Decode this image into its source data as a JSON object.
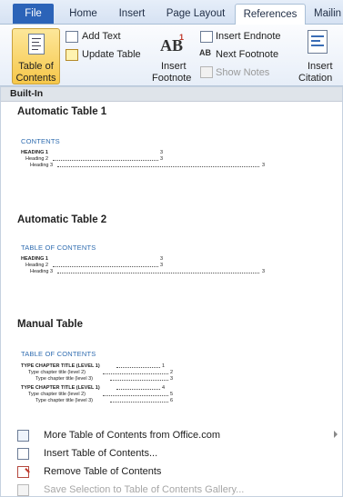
{
  "tabs": {
    "file": "File",
    "home": "Home",
    "insert": "Insert",
    "page_layout": "Page Layout",
    "references": "References",
    "mailings": "Mailin"
  },
  "ribbon": {
    "toc_label_line1": "Table of",
    "toc_label_line2": "Contents",
    "add_text": "Add Text",
    "update_table": "Update Table",
    "ab_icon": "AB",
    "ab_sup": "1",
    "insert_footnote_line1": "Insert",
    "insert_footnote_line2": "Footnote",
    "next_fn_icon": "AB",
    "insert_endnote": "Insert Endnote",
    "next_footnote": "Next Footnote",
    "show_notes": "Show Notes",
    "insert_citation_line1": "Insert",
    "insert_citation_line2": "Citation"
  },
  "gallery": {
    "section_header": "Built-In",
    "items": [
      {
        "title": "Automatic Table 1",
        "preview_header": "CONTENTS",
        "lines": [
          {
            "text": "HEADING 1",
            "page": "3"
          },
          {
            "text": "Heading 2",
            "page": "3"
          },
          {
            "text": "Heading 3",
            "page": "3"
          }
        ]
      },
      {
        "title": "Automatic Table 2",
        "preview_header": "TABLE OF CONTENTS",
        "lines": [
          {
            "text": "HEADING 1",
            "page": "3"
          },
          {
            "text": "Heading 2",
            "page": "3"
          },
          {
            "text": "Heading 3",
            "page": "3"
          }
        ]
      },
      {
        "title": "Manual Table",
        "preview_header": "TABLE OF CONTENTS",
        "lines": [
          {
            "text": "TYPE CHAPTER TITLE (LEVEL 1)",
            "page": "1"
          },
          {
            "text": "Type chapter title (level 2)",
            "page": "2"
          },
          {
            "text": "Type chapter title (level 3)",
            "page": "3"
          },
          {
            "text": "TYPE CHAPTER TITLE (LEVEL 1)",
            "page": "4"
          },
          {
            "text": "Type chapter title (level 2)",
            "page": "5"
          },
          {
            "text": "Type chapter title (level 3)",
            "page": "6"
          }
        ]
      }
    ]
  },
  "menu": {
    "more": "More Table of Contents from Office.com",
    "insert": "Insert Table of Contents...",
    "remove": "Remove Table of Contents",
    "save": "Save Selection to Table of Contents Gallery..."
  }
}
